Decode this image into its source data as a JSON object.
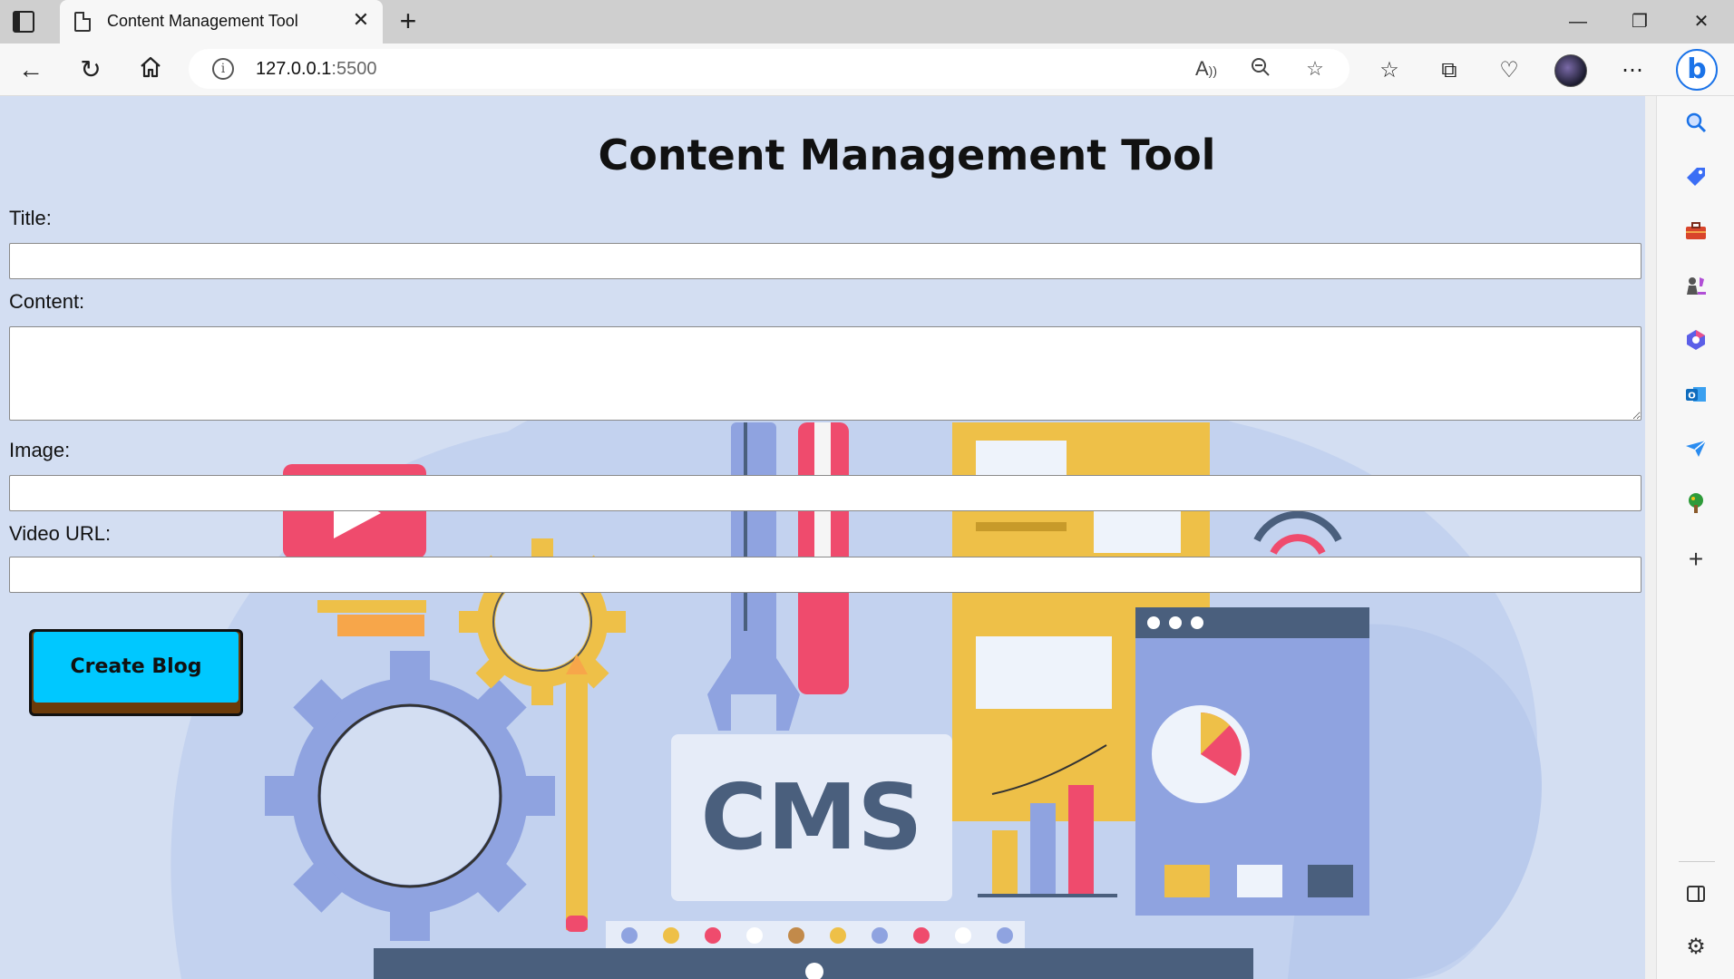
{
  "browser": {
    "tab_title": "Content Management Tool",
    "tab_close": "✕",
    "new_tab": "+",
    "url_host": "127.0.0.1",
    "url_port": ":5500",
    "window_controls": {
      "minimize": "—",
      "restore": "❐",
      "close": "✕"
    }
  },
  "page": {
    "title": "Content Management Tool",
    "fields": {
      "title_label": "Title:",
      "title_value": "",
      "content_label": "Content:",
      "content_value": "",
      "image_label": "Image:",
      "image_value": "",
      "video_label": "Video URL:",
      "video_value": ""
    },
    "create_button": "Create Blog",
    "illustration_text": "CMS"
  },
  "colors": {
    "page_background": "#d3def2",
    "button_face": "#00c8ff",
    "button_shadow": "#6b3b0a"
  }
}
